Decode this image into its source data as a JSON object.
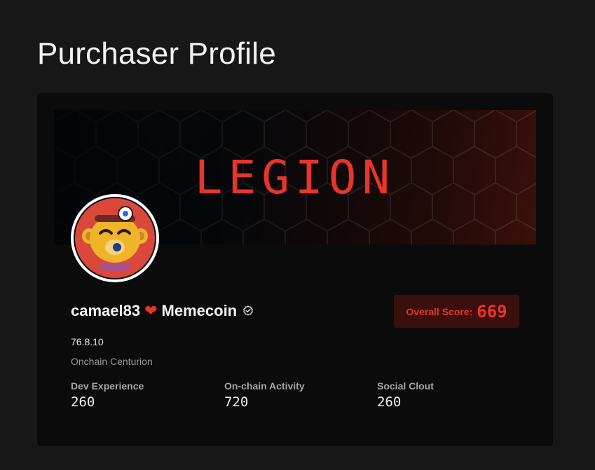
{
  "page": {
    "title": "Purchaser Profile"
  },
  "banner": {
    "logo_text": "LEGION",
    "accent_color": "#e8352a"
  },
  "avatar": {
    "icon": "monkey-mascot-avatar"
  },
  "profile": {
    "name": "camael83",
    "heart_icon": "heart-icon",
    "project": "Memecoin",
    "verified_icon": "verified-badge-icon",
    "version": "76.8.10",
    "rank": "Onchain Centurion"
  },
  "score": {
    "label": "Overall Score:",
    "value": "669"
  },
  "stats": [
    {
      "label": "Dev Experience",
      "value": "260"
    },
    {
      "label": "On-chain Activity",
      "value": "720"
    },
    {
      "label": "Social Clout",
      "value": "260"
    }
  ],
  "colors": {
    "background": "#171717",
    "card": "#0b0b0b",
    "accent": "#e8352a",
    "score_badge_bg": "#3a0f0d"
  }
}
